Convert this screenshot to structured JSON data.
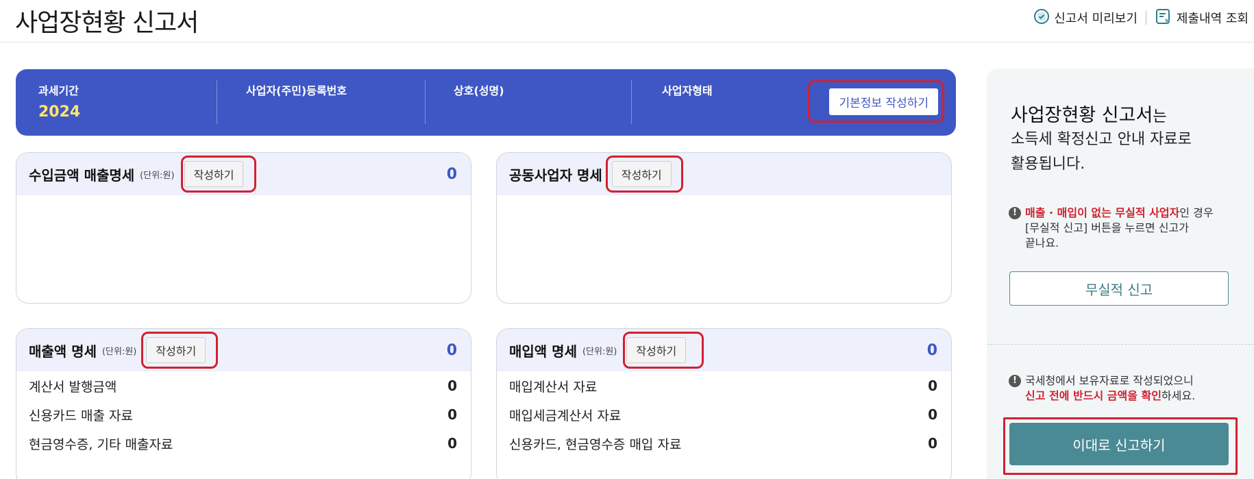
{
  "header": {
    "title": "사업장현황 신고서",
    "preview_label": "신고서 미리보기",
    "history_label": "제출내역 조회"
  },
  "info": {
    "period_label": "과세기간",
    "period_value": "2024",
    "regno_label": "사업자(주민)등록번호",
    "name_label": "상호(성명)",
    "type_label": "사업자형태",
    "basic_button": "기본정보 작성하기"
  },
  "cards": {
    "income": {
      "title": "수입금액 매출명세",
      "unit": "(단위:원)",
      "button": "작성하기",
      "total": "0"
    },
    "partners": {
      "title": "공동사업자 명세",
      "button": "작성하기",
      "total": "0"
    },
    "sales": {
      "title": "매출액 명세",
      "unit": "(단위:원)",
      "button": "작성하기",
      "total": "0",
      "rows": [
        {
          "label": "계산서 발행금액",
          "value": "0"
        },
        {
          "label": "신용카드 매출 자료",
          "value": "0"
        },
        {
          "label": "현금영수증, 기타 매출자료",
          "value": "0"
        }
      ]
    },
    "purchase": {
      "title": "매입액 명세",
      "unit": "(단위:원)",
      "button": "작성하기",
      "total": "0",
      "rows": [
        {
          "label": "매입계산서 자료",
          "value": "0"
        },
        {
          "label": "매입세금계산서 자료",
          "value": "0"
        },
        {
          "label": "신용카드, 현금영수증 매입 자료",
          "value": "0"
        }
      ]
    }
  },
  "side": {
    "title": "사업장현황 신고서",
    "title_suffix": "는",
    "subtitle_line1": "소득세 확정신고 안내 자료로",
    "subtitle_line2": "활용됩니다.",
    "notice1_highlight": "매출 · 매입이 없는 무실적 사업자",
    "notice1_rest1": "인 경우",
    "notice1_rest2": "[무실적 신고] 버튼을 누르면 신고가",
    "notice1_rest3": "끝나요.",
    "zero_button": "무실적 신고",
    "notice2_line1": "국세청에서 보유자료로 작성되었으니",
    "notice2_highlight": "신고 전에 반드시 금액을 확인",
    "notice2_rest": "하세요.",
    "submit_button": "이대로 신고하기"
  },
  "colors": {
    "primary_blue": "#3f57c4",
    "highlight_yellow": "#ffe66a",
    "teal": "#4a8a94",
    "alert_red": "#d3202f"
  }
}
